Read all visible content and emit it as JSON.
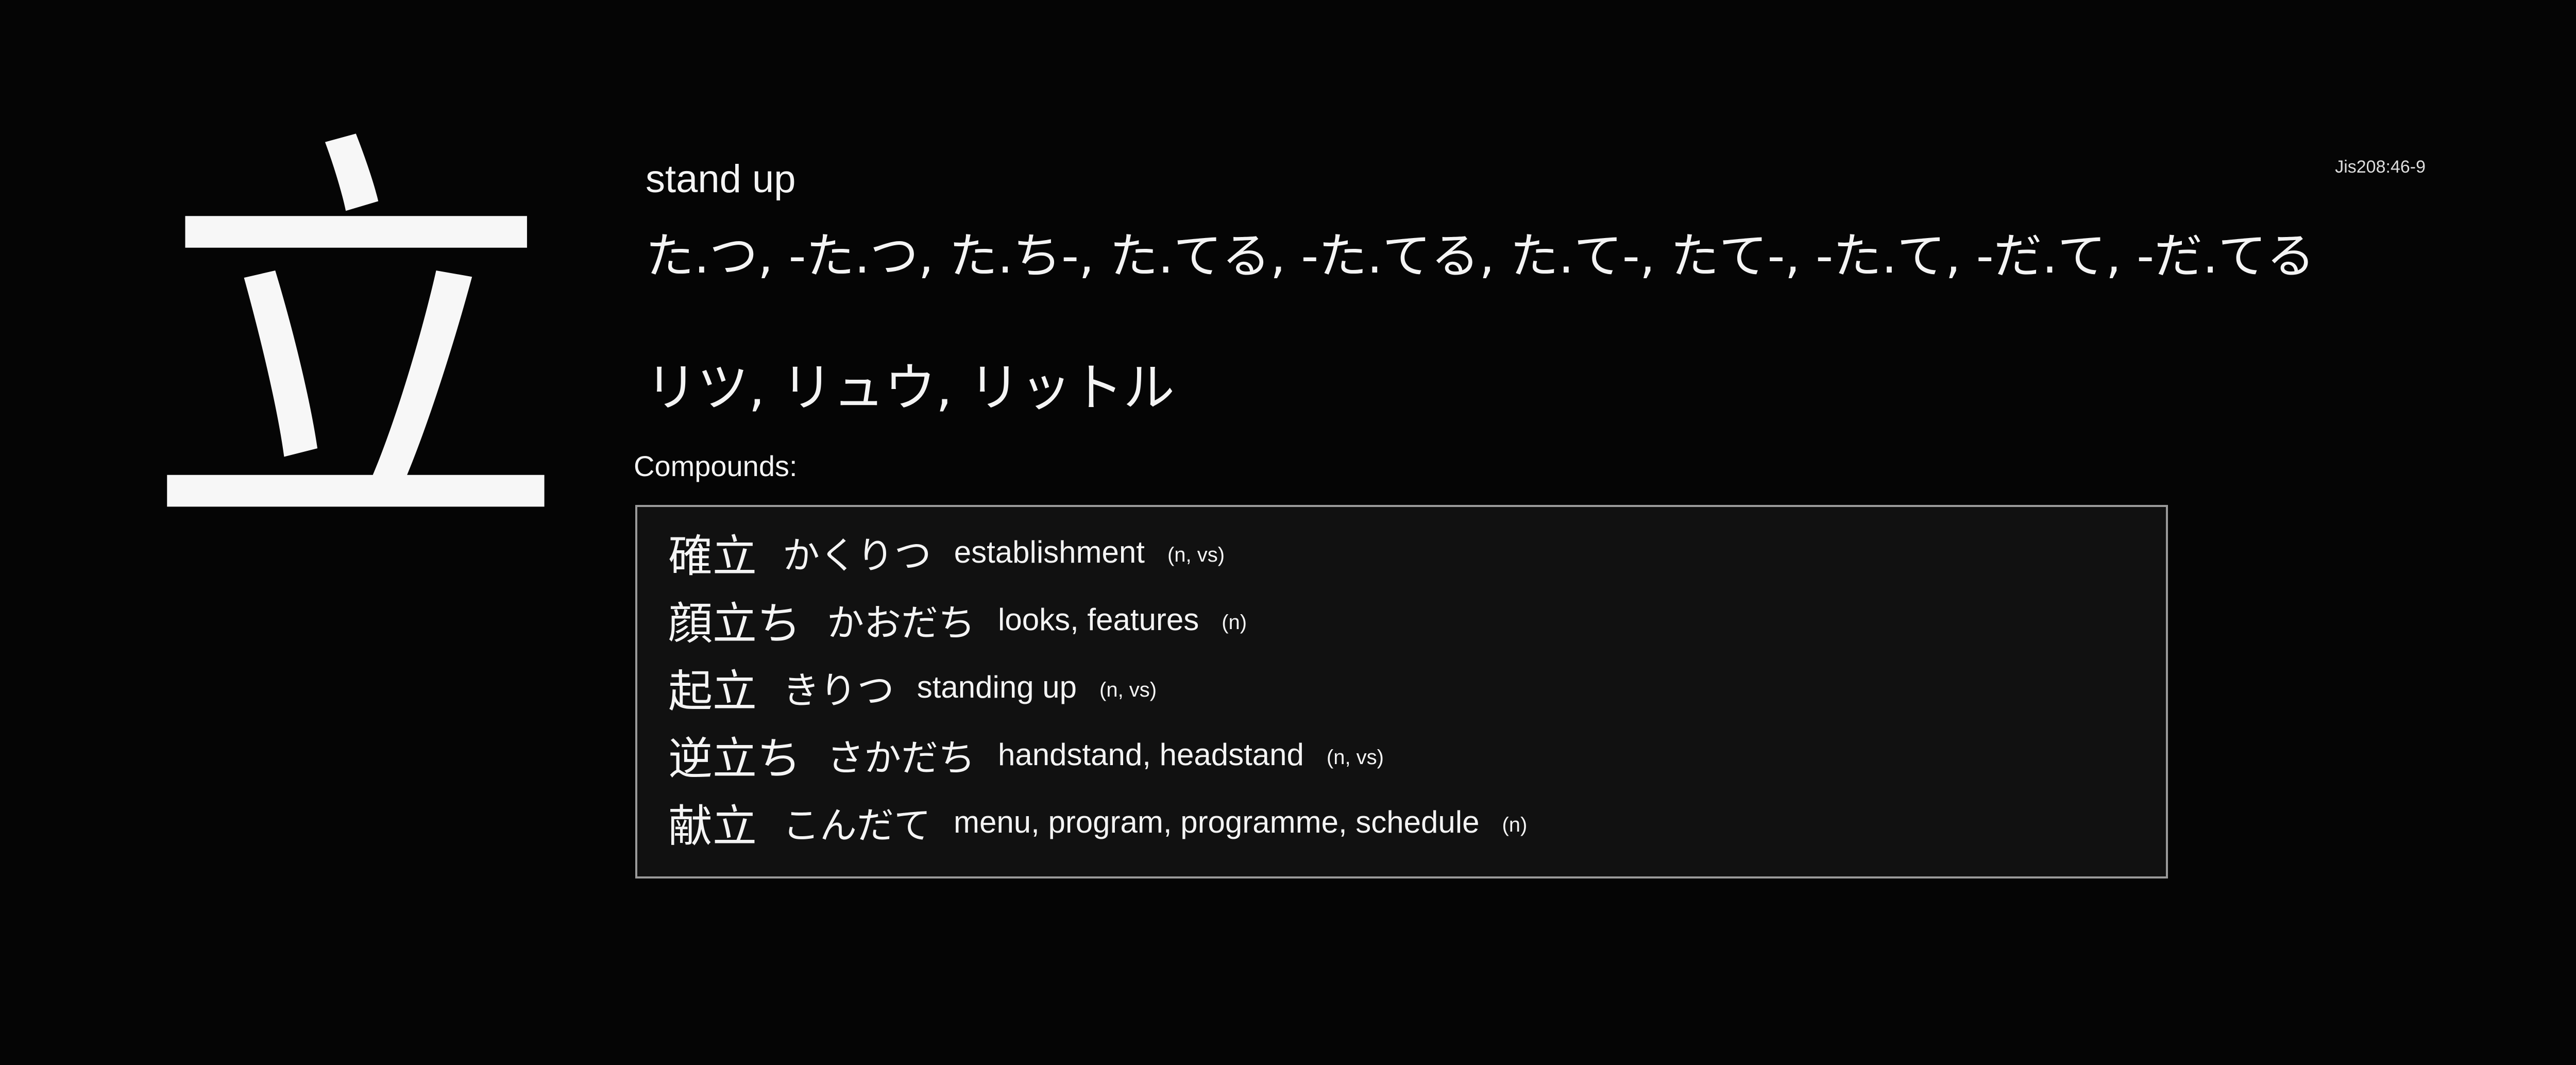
{
  "kanji": "立",
  "jis_code": "Jis208:46-9",
  "meaning": "stand up",
  "kun_readings": "た.つ, -た.つ, た.ち-, た.てる, -た.てる, た.て-, たて-, -た.て, -だ.て, -だ.てる",
  "on_readings": "リツ, リュウ, リットル",
  "compounds_label": "Compounds:",
  "compounds": [
    {
      "word": "確立",
      "reading": "かくりつ",
      "gloss": "establishment",
      "pos": "(n, vs)"
    },
    {
      "word": "顔立ち",
      "reading": "かおだち",
      "gloss": "looks, features",
      "pos": "(n)"
    },
    {
      "word": "起立",
      "reading": "きりつ",
      "gloss": "standing up",
      "pos": "(n, vs)"
    },
    {
      "word": "逆立ち",
      "reading": "さかだち",
      "gloss": "handstand, headstand",
      "pos": "(n, vs)"
    },
    {
      "word": "献立",
      "reading": "こんだて",
      "gloss": "menu, program, programme, schedule",
      "pos": "(n)"
    }
  ]
}
